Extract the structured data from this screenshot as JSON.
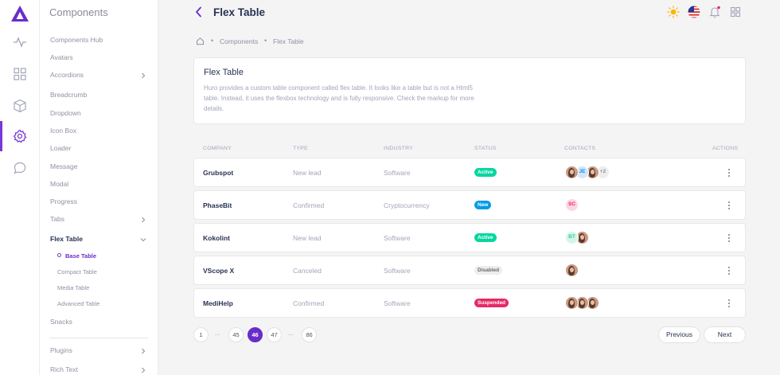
{
  "panel": {
    "title": "Components",
    "items": [
      {
        "label": "Components Hub"
      },
      {
        "label": "Avatars"
      },
      {
        "label": "Accordions"
      },
      {
        "label": "Breadcrumb"
      },
      {
        "label": "Dropdown"
      },
      {
        "label": "Icon Box"
      },
      {
        "label": "Loader"
      },
      {
        "label": "Message"
      },
      {
        "label": "Modal"
      },
      {
        "label": "Progress"
      },
      {
        "label": "Tabs"
      },
      {
        "label": "Flex Table"
      },
      {
        "label": "Snacks"
      },
      {
        "label": "Plugins"
      },
      {
        "label": "Rich Text"
      }
    ],
    "subitems": [
      {
        "label": "Base Table"
      },
      {
        "label": "Compact Table"
      },
      {
        "label": "Media Table"
      },
      {
        "label": "Advanced Table"
      }
    ]
  },
  "header": {
    "title": "Flex Table",
    "icons": [
      "sun-icon",
      "us-flag-icon",
      "bell-icon",
      "apps-grid-icon"
    ]
  },
  "breadcrumb": [
    "Components",
    "Flex Table"
  ],
  "intro": {
    "title": "Flex Table",
    "text": "Huro provides a custom table component called flex table. It looks like a table but is not a Html5 table. Instead, it uses the flexbox technology and is fully responsive. Check the markup for more details."
  },
  "table": {
    "headers": [
      "COMPANY",
      "TYPE",
      "INDUSTRY",
      "STATUS",
      "CONTACTS",
      "ACTIONS"
    ],
    "rows": [
      {
        "company": "Grubspot",
        "type": "New lead",
        "industry": "Software",
        "status": "Active",
        "status_color": "#06d6a0",
        "status_text_color": "#ffffff",
        "contacts": [
          {
            "kind": "photo"
          },
          {
            "kind": "initials",
            "text": "JE",
            "bg": "#cfe7fb",
            "fg": "#2b8de1"
          },
          {
            "kind": "photo"
          },
          {
            "kind": "more",
            "text": "+2",
            "bg": "#ededed",
            "fg": "#8f92a1"
          }
        ]
      },
      {
        "company": "PhaseBit",
        "type": "Confirmed",
        "industry": "Cryptocurrency",
        "status": "New",
        "status_color": "#039be5",
        "status_text_color": "#ffffff",
        "contacts": [
          {
            "kind": "initials",
            "text": "SC",
            "bg": "#fbd7e1",
            "fg": "#e62965"
          }
        ]
      },
      {
        "company": "Kokolint",
        "type": "New lead",
        "industry": "Software",
        "status": "Active",
        "status_color": "#06d6a0",
        "status_text_color": "#ffffff",
        "contacts": [
          {
            "kind": "initials",
            "text": "BT",
            "bg": "#d4f6ea",
            "fg": "#3cc99a"
          },
          {
            "kind": "photo"
          }
        ]
      },
      {
        "company": "VScope X",
        "type": "Canceled",
        "industry": "Software",
        "status": "Disabled",
        "status_color": "#ededed",
        "status_text_color": "#6b6b6b",
        "contacts": [
          {
            "kind": "photo"
          }
        ]
      },
      {
        "company": "MediHelp",
        "type": "Confirmed",
        "industry": "Software",
        "status": "Suspended",
        "status_color": "#e62965",
        "status_text_color": "#ffffff",
        "contacts": [
          {
            "kind": "photo"
          },
          {
            "kind": "photo"
          },
          {
            "kind": "photo"
          }
        ]
      }
    ]
  },
  "pagination": {
    "pages": [
      "1",
      "45",
      "46",
      "47",
      "86"
    ],
    "dots": "...",
    "current": "46",
    "previous": "Previous",
    "next": "Next"
  },
  "colors": {
    "accent": "#6a2cc9",
    "logo": "#6a2cc9"
  }
}
